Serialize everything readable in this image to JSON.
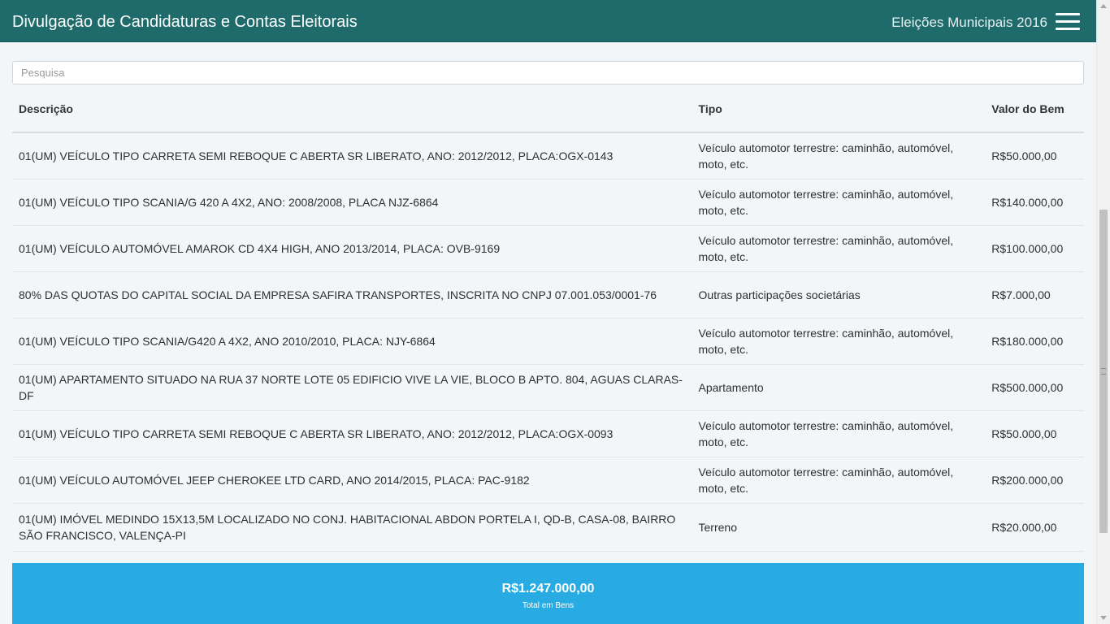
{
  "header": {
    "title": "Divulgação de Candidaturas e Contas Eleitorais",
    "election": "Eleições Municipais 2016",
    "menu_icon": "hamburger-menu-icon"
  },
  "search": {
    "placeholder": "Pesquisa",
    "value": ""
  },
  "table": {
    "headers": {
      "descricao": "Descrição",
      "tipo": "Tipo",
      "valor": "Valor do Bem"
    },
    "rows": [
      {
        "descricao": "01(UM) VEÍCULO TIPO CARRETA SEMI REBOQUE C ABERTA SR LIBERATO, ANO: 2012/2012, PLACA:OGX-0143",
        "tipo": "Veículo automotor terrestre: caminhão, automóvel, moto, etc.",
        "valor": "R$50.000,00"
      },
      {
        "descricao": "01(UM) VEÍCULO TIPO SCANIA/G 420 A 4X2, ANO: 2008/2008, PLACA NJZ-6864",
        "tipo": "Veículo automotor terrestre: caminhão, automóvel, moto, etc.",
        "valor": "R$140.000,00"
      },
      {
        "descricao": "01(UM) VEÍCULO AUTOMÓVEL AMAROK CD 4X4 HIGH, ANO 2013/2014, PLACA: OVB-9169",
        "tipo": "Veículo automotor terrestre: caminhão, automóvel, moto, etc.",
        "valor": "R$100.000,00"
      },
      {
        "descricao": "80% DAS QUOTAS DO CAPITAL SOCIAL DA EMPRESA SAFIRA TRANSPORTES, INSCRITA NO CNPJ 07.001.053/0001-76",
        "tipo": "Outras participações societárias",
        "valor": "R$7.000,00"
      },
      {
        "descricao": "01(UM) VEÍCULO TIPO SCANIA/G420 A 4X2, ANO 2010/2010, PLACA: NJY-6864",
        "tipo": "Veículo automotor terrestre: caminhão, automóvel, moto, etc.",
        "valor": "R$180.000,00"
      },
      {
        "descricao": "01(UM) APARTAMENTO SITUADO NA RUA 37 NORTE LOTE 05 EDIFICIO VIVE LA VIE, BLOCO B APTO. 804, AGUAS CLARAS-DF",
        "tipo": "Apartamento",
        "valor": "R$500.000,00"
      },
      {
        "descricao": "01(UM) VEÍCULO TIPO CARRETA SEMI REBOQUE C ABERTA SR LIBERATO, ANO: 2012/2012, PLACA:OGX-0093",
        "tipo": "Veículo automotor terrestre: caminhão, automóvel, moto, etc.",
        "valor": "R$50.000,00"
      },
      {
        "descricao": "01(UM) VEÍCULO AUTOMÓVEL JEEP CHEROKEE LTD CARD, ANO 2014/2015, PLACA: PAC-9182",
        "tipo": "Veículo automotor terrestre: caminhão, automóvel, moto, etc.",
        "valor": "R$200.000,00"
      },
      {
        "descricao": "01(UM) IMÓVEL MEDINDO 15X13,5M LOCALIZADO NO CONJ. HABITACIONAL ABDON PORTELA I, QD-B, CASA-08, BAIRRO SÃO FRANCISCO, VALENÇA-PI",
        "tipo": "Terreno",
        "valor": "R$20.000,00"
      }
    ]
  },
  "total": {
    "amount": "R$1.247.000,00",
    "label": "Total em Bens"
  },
  "colors": {
    "header_bg": "#1f6b6b",
    "total_bg": "#27abe2",
    "content_bg": "#f3f6f8"
  }
}
